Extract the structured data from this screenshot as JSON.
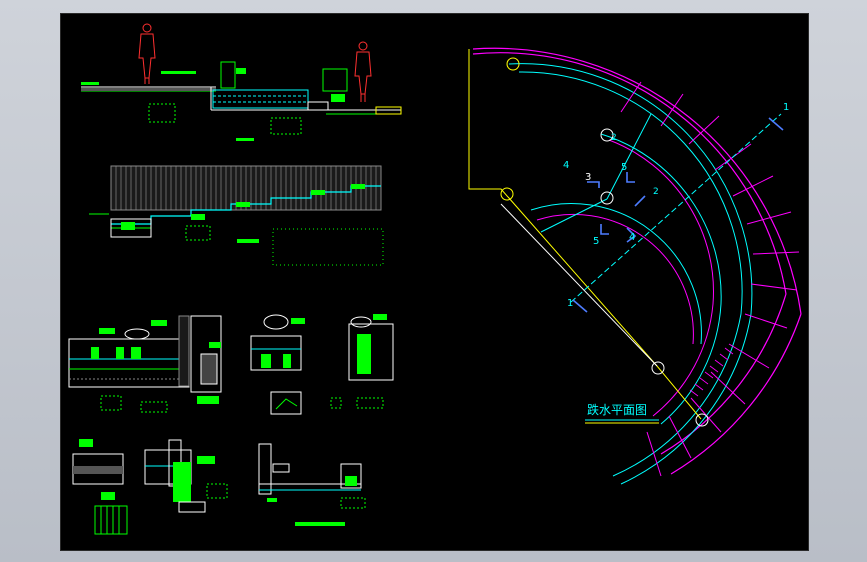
{
  "drawing": {
    "plan_title": "跌水平面图",
    "section_marks": {
      "one": "1",
      "two": "2",
      "three": "3",
      "four": "4",
      "five": "5"
    }
  }
}
